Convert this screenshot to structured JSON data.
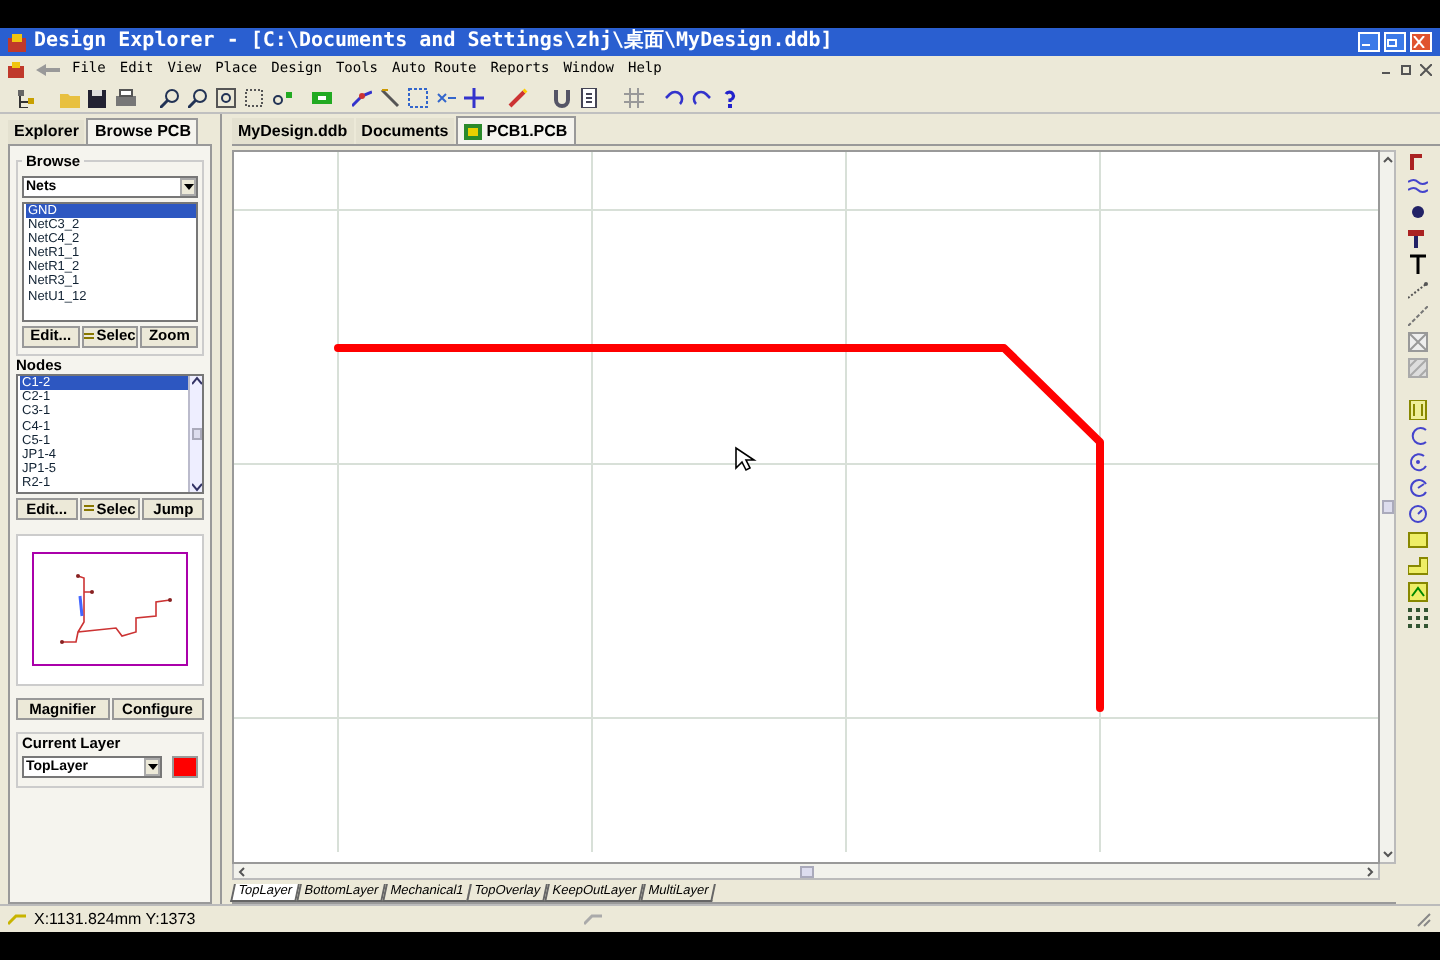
{
  "window": {
    "title": "Design Explorer - [C:\\Documents and Settings\\zhj\\桌面\\MyDesign.ddb]"
  },
  "menu": [
    "File",
    "Edit",
    "View",
    "Place",
    "Design",
    "Tools",
    "Auto Route",
    "Reports",
    "Window",
    "Help"
  ],
  "panel_tabs": [
    {
      "label": "Explorer",
      "selected": false
    },
    {
      "label": "Browse PCB",
      "selected": true
    }
  ],
  "browse": {
    "label": "Browse",
    "dropdown": "Nets",
    "items": [
      {
        "label": "GND",
        "selected": true
      },
      {
        "label": "NetC3_2",
        "selected": false
      },
      {
        "label": "NetC4_2",
        "selected": false
      },
      {
        "label": "NetR1_1",
        "selected": false
      },
      {
        "label": "NetR1_2",
        "selected": false
      },
      {
        "label": "NetR3_1",
        "selected": false
      },
      {
        "label": "NetU1_12",
        "selected": false
      }
    ],
    "buttons": [
      "Edit...",
      "Selec",
      "Zoom"
    ]
  },
  "nodes": {
    "label": "Nodes",
    "items": [
      {
        "label": "C1-2",
        "selected": true
      },
      {
        "label": "C2-1",
        "selected": false
      },
      {
        "label": "C3-1",
        "selected": false
      },
      {
        "label": "C4-1",
        "selected": false
      },
      {
        "label": "C5-1",
        "selected": false
      },
      {
        "label": "JP1-4",
        "selected": false
      },
      {
        "label": "JP1-5",
        "selected": false
      },
      {
        "label": "R2-1",
        "selected": false
      }
    ],
    "buttons": [
      "Edit...",
      "Selec",
      "Jump"
    ]
  },
  "view_buttons": [
    "Magnifier",
    "Configure"
  ],
  "current_layer": {
    "label": "Current Layer",
    "value": "TopLayer",
    "color": "#ff0000"
  },
  "doc_tabs": [
    {
      "label": "MyDesign.ddb",
      "selected": false
    },
    {
      "label": "Documents",
      "selected": false
    },
    {
      "label": "PCB1.PCB",
      "selected": true
    }
  ],
  "layer_tabs": [
    {
      "label": "TopLayer",
      "selected": true
    },
    {
      "label": "BottomLayer",
      "selected": false
    },
    {
      "label": "Mechanical1",
      "selected": false
    },
    {
      "label": "TopOverlay",
      "selected": false
    },
    {
      "label": "KeepOutLayer",
      "selected": false
    },
    {
      "label": "MultiLayer",
      "selected": false
    }
  ],
  "status_bar": {
    "coordinates": "X:1131.824mm Y:1373"
  }
}
